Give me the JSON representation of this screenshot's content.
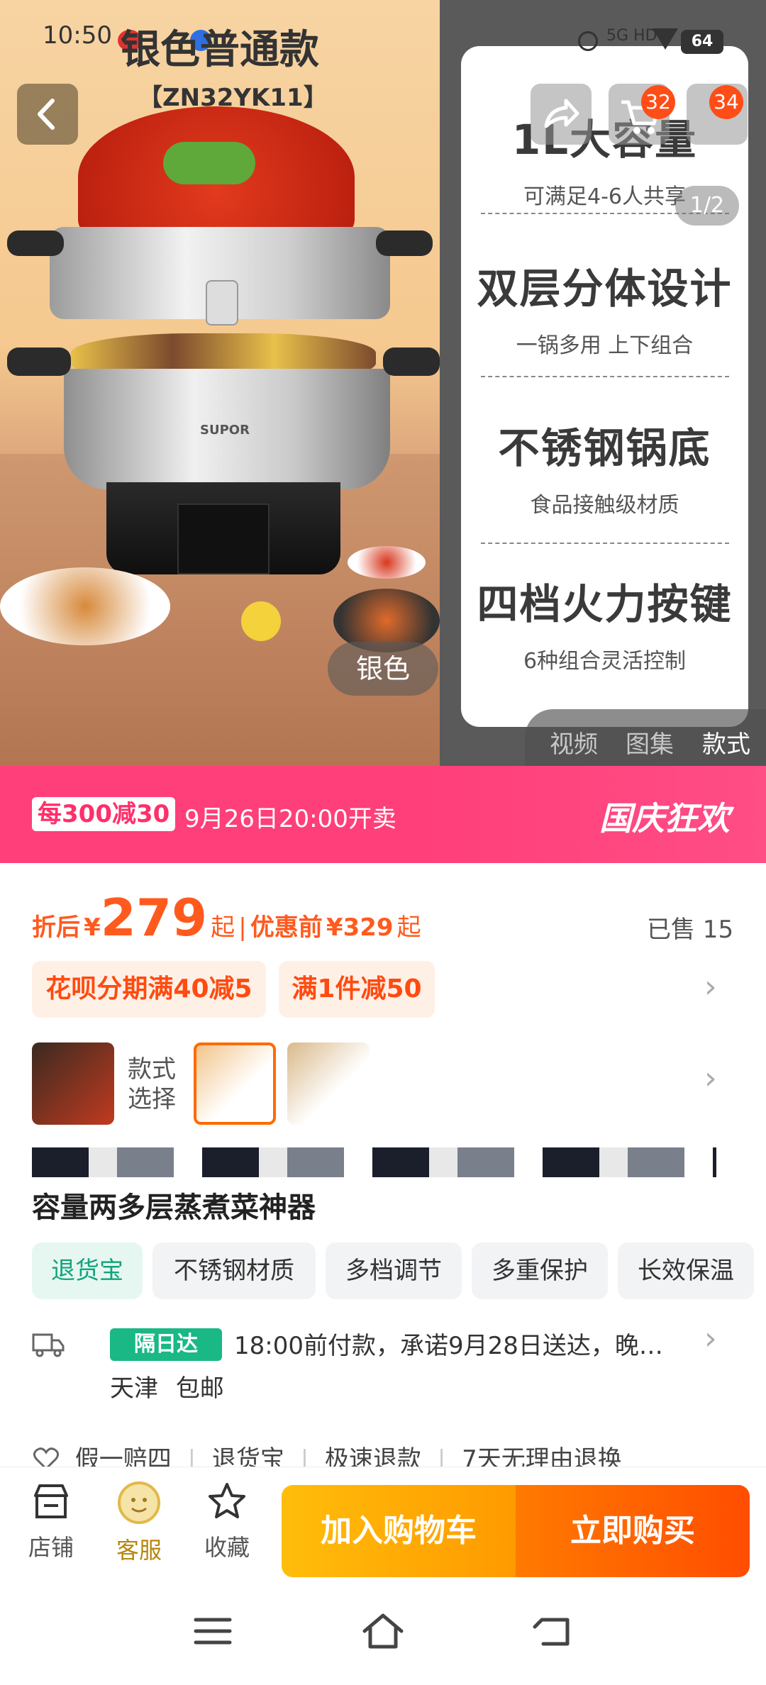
{
  "status_bar": {
    "time": "10:50",
    "network": "5G HD",
    "battery": "64"
  },
  "product": {
    "name": "银色普通款",
    "model_code": "【ZN32YK11】",
    "brand_mark": "SUPOR"
  },
  "gallery": {
    "page_indicator": "1/2",
    "variant_label": "银色",
    "cart_badge": "32",
    "more_badge": "34",
    "tabs": [
      {
        "label": "视频",
        "active": false
      },
      {
        "label": "图集",
        "active": false
      },
      {
        "label": "款式",
        "active": true
      }
    ],
    "specs": [
      {
        "title": "1L大容量",
        "sub": "可满足4-6人共享"
      },
      {
        "title": "双层分体设计",
        "sub": "一锅多用 上下组合"
      },
      {
        "title": "不锈钢锅底",
        "sub": "食品接触级材质"
      },
      {
        "title": "四档火力按键",
        "sub": "6种组合灵活控制"
      }
    ]
  },
  "promo": {
    "discount": "每300减30",
    "sale_time": "9月26日20:00开卖",
    "event": "国庆狂欢"
  },
  "price": {
    "after_label": "折后",
    "currency": "¥",
    "after_value": "279",
    "qi": "起",
    "separator": "|",
    "before_label": "优惠前",
    "before_value": "¥329",
    "sold": "已售 15"
  },
  "coupons": [
    "花呗分期满40减5",
    "满1件减50"
  ],
  "style_select": {
    "label_line1": "款式",
    "label_line2": "选择"
  },
  "title_line": "容量两多层蒸煮菜神器",
  "tags": [
    "退货宝",
    "不锈钢材质",
    "多档调节",
    "多重保护",
    "长效保温"
  ],
  "shipping": {
    "badge": "隔日达",
    "text": "18:00前付款，承诺9月28日送达，晚…",
    "city": "天津",
    "free": "包邮"
  },
  "guarantees": [
    "假一赔四",
    "退货宝",
    "极速退款",
    "7天无理由退换"
  ],
  "bottom_bar": {
    "shop": "店铺",
    "service": "客服",
    "favorite": "收藏",
    "add_cart": "加入购物车",
    "buy_now": "立即购买"
  },
  "colors": {
    "accent_orange": "#ff5a1e",
    "promo_pink": "#ff3f79",
    "green": "#19b884"
  }
}
